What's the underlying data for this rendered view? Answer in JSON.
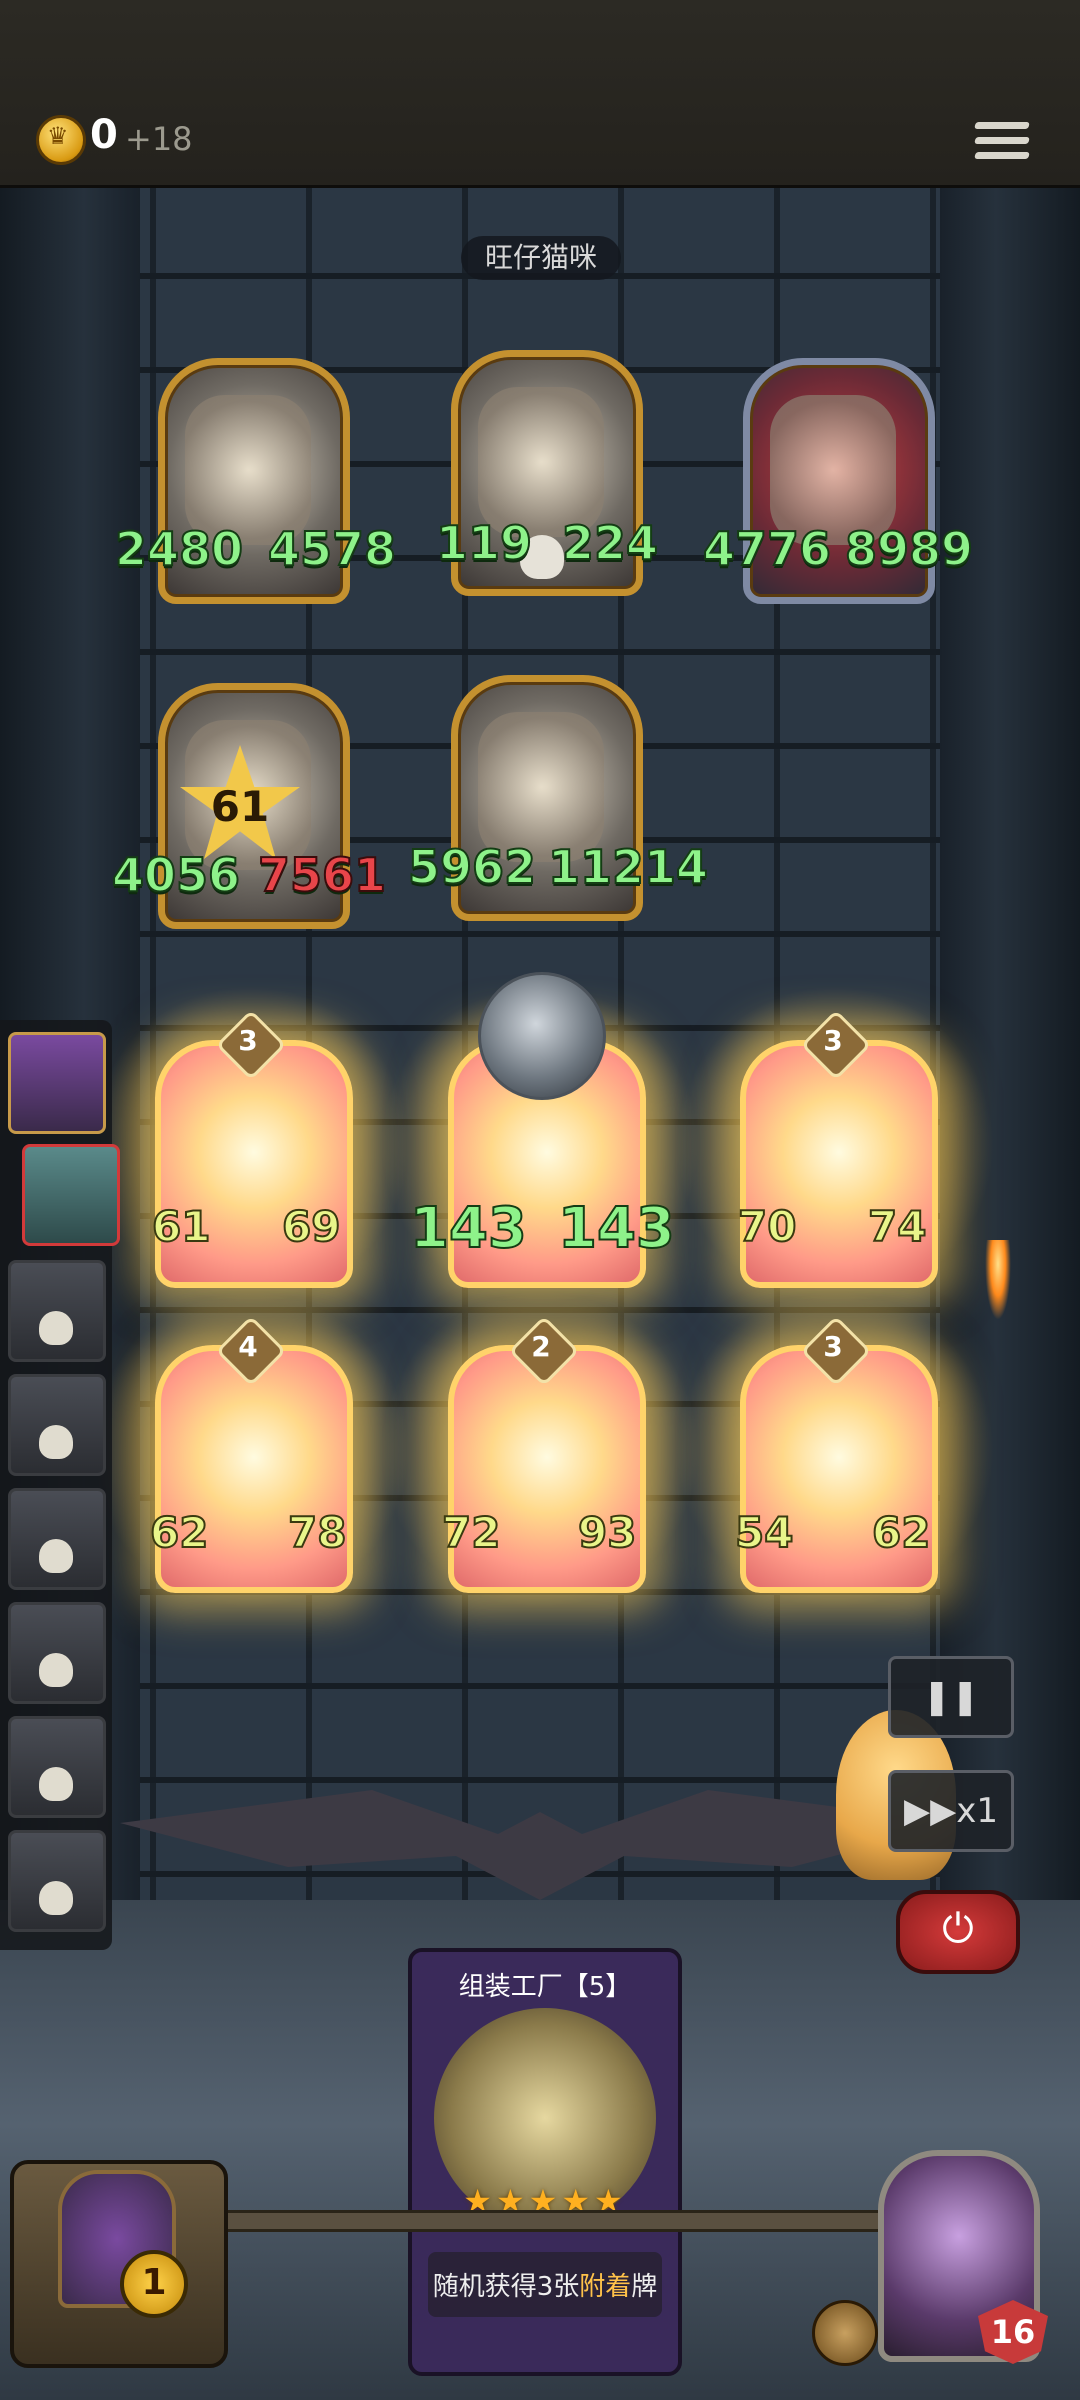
{
  "top": {
    "gold": "0",
    "gold_gain": "+18"
  },
  "opponent": {
    "name": "旺仔猫咪"
  },
  "enemy_cards": [
    {
      "attack": "2480",
      "health": "4578"
    },
    {
      "attack": "119",
      "health": "224"
    },
    {
      "attack": "4776",
      "health": "8989"
    },
    {
      "attack": "4056",
      "health": "7561",
      "badge": "61"
    },
    {
      "attack": "5962",
      "health": "11214"
    }
  ],
  "player_cards": [
    {
      "level": "3",
      "attack": "61",
      "health": "69"
    },
    {
      "level": "",
      "attack": "143",
      "health": "143"
    },
    {
      "level": "3",
      "attack": "70",
      "health": "74"
    },
    {
      "level": "4",
      "attack": "62",
      "health": "78"
    },
    {
      "level": "2",
      "attack": "72",
      "health": "93"
    },
    {
      "level": "3",
      "attack": "54",
      "health": "62"
    }
  ],
  "controls": {
    "speed": "▶▶x1"
  },
  "draw_card": {
    "title": "组装工厂【5】",
    "stars": "★★★★★",
    "desc_before": "随机获得3张",
    "desc_highlight": "附着",
    "desc_after": "牌"
  },
  "deck": {
    "count": "1"
  },
  "player": {
    "hp": "16"
  }
}
